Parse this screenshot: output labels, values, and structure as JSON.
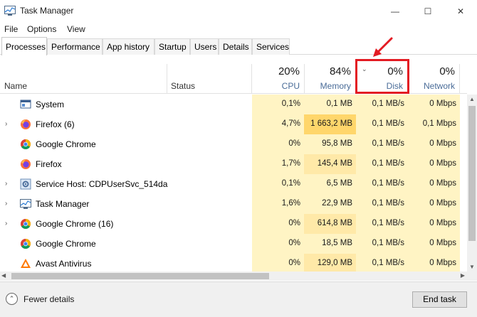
{
  "window": {
    "title": "Task Manager",
    "min_glyph": "—",
    "max_glyph": "☐",
    "close_glyph": "✕"
  },
  "menu": [
    "File",
    "Options",
    "View"
  ],
  "tabs": [
    "Processes",
    "Performance",
    "App history",
    "Startup",
    "Users",
    "Details",
    "Services"
  ],
  "active_tab": "Processes",
  "columns": {
    "name": "Name",
    "status": "Status",
    "cpu": {
      "pct": "20%",
      "label": "CPU"
    },
    "memory": {
      "pct": "84%",
      "label": "Memory"
    },
    "disk": {
      "pct": "0%",
      "label": "Disk",
      "sort_glyph": "⌄"
    },
    "network": {
      "pct": "0%",
      "label": "Network"
    }
  },
  "rows": [
    {
      "expander": "",
      "icon": "system-icon",
      "name": "System",
      "cpu": "0,1%",
      "memory": "0,1 MB",
      "disk": "0,1 MB/s",
      "network": "0 Mbps"
    },
    {
      "expander": "›",
      "icon": "firefox-icon",
      "name": "Firefox (6)",
      "cpu": "4,7%",
      "memory": "1 663,2 MB",
      "disk": "0,1 MB/s",
      "network": "0,1 Mbps"
    },
    {
      "expander": "",
      "icon": "chrome-icon",
      "name": "Google Chrome",
      "cpu": "0%",
      "memory": "95,8 MB",
      "disk": "0,1 MB/s",
      "network": "0 Mbps"
    },
    {
      "expander": "",
      "icon": "firefox-icon",
      "name": "Firefox",
      "cpu": "1,7%",
      "memory": "145,4 MB",
      "disk": "0,1 MB/s",
      "network": "0 Mbps"
    },
    {
      "expander": "›",
      "icon": "service-host-icon",
      "name": "Service Host: CDPUserSvc_514da",
      "cpu": "0,1%",
      "memory": "6,5 MB",
      "disk": "0,1 MB/s",
      "network": "0 Mbps"
    },
    {
      "expander": "›",
      "icon": "task-manager-icon",
      "name": "Task Manager",
      "cpu": "1,6%",
      "memory": "22,9 MB",
      "disk": "0,1 MB/s",
      "network": "0 Mbps"
    },
    {
      "expander": "›",
      "icon": "chrome-icon",
      "name": "Google Chrome (16)",
      "cpu": "0%",
      "memory": "614,8 MB",
      "disk": "0,1 MB/s",
      "network": "0 Mbps"
    },
    {
      "expander": "",
      "icon": "chrome-icon",
      "name": "Google Chrome",
      "cpu": "0%",
      "memory": "18,5 MB",
      "disk": "0,1 MB/s",
      "network": "0 Mbps"
    },
    {
      "expander": "",
      "icon": "avast-icon",
      "name": "Avast Antivirus",
      "cpu": "0%",
      "memory": "129,0 MB",
      "disk": "0,1 MB/s",
      "network": "0 Mbps"
    }
  ],
  "footer": {
    "fewer_details": "Fewer details",
    "fewer_icon_glyph": "⌃",
    "end_task": "End task"
  },
  "colors": {
    "heat_light": "#fff4c4",
    "heat_medium": "#ffe9a8",
    "heat_strong": "#ffd66b",
    "header_heat": "#fff4c4",
    "annotation_red": "#e31b23",
    "header_label": "#4a6c98"
  }
}
